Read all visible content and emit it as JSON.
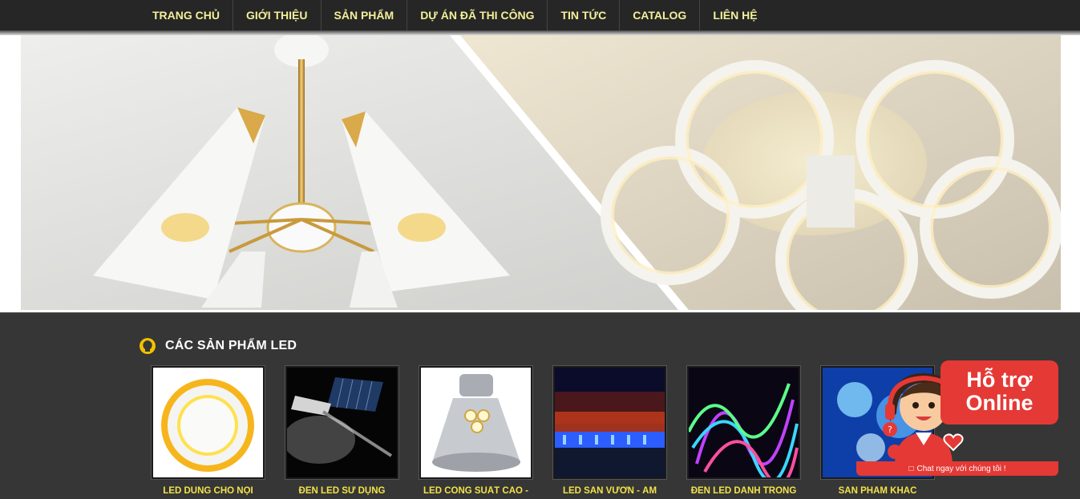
{
  "nav": {
    "items": [
      {
        "label": "TRANG CHỦ"
      },
      {
        "label": "GIỚI THIỆU"
      },
      {
        "label": "SẢN PHẨM"
      },
      {
        "label": "DỰ ÁN ĐÃ THI CÔNG"
      },
      {
        "label": "TIN TỨC"
      },
      {
        "label": "CATALOG"
      },
      {
        "label": "LIÊN HỆ"
      }
    ]
  },
  "banner": {
    "slider_progress": 0.42
  },
  "products": {
    "title": "CÁC SẢN PHẨM LED",
    "items": [
      {
        "name": "LED DÙNG CHO NỘI",
        "image": "led-ring-panel"
      },
      {
        "name": "ĐÈN LED SỬ DỤNG",
        "image": "solar-street-light"
      },
      {
        "name": "LED CÔNG SUẤT CAO -",
        "image": "high-bay-lamp"
      },
      {
        "name": "LED SÂN VƯỜN - ÂM",
        "image": "garden-night-lights"
      },
      {
        "name": "ĐÈN LED DÀNH TRONG",
        "image": "led-strip-lights"
      },
      {
        "name": "SẢN PHẨM KHÁC",
        "image": "blue-lights"
      }
    ]
  },
  "support": {
    "line1": "Hỗ trợ",
    "line2": "Online",
    "chat_text": "Chat ngay với chúng tôi !"
  },
  "colors": {
    "nav_text": "#f3ef9a",
    "product_name": "#f2e24a",
    "support_red": "#e53935"
  }
}
